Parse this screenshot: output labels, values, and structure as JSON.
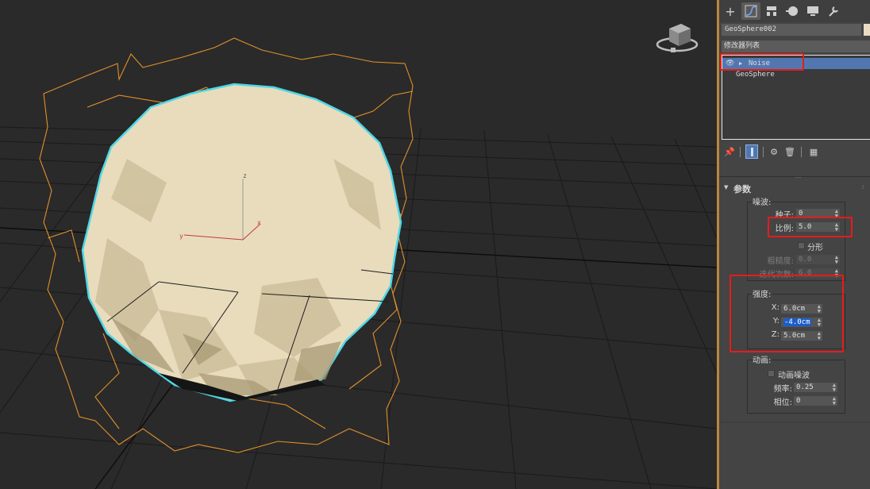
{
  "panel": {
    "tabs": [
      {
        "name": "create-tab",
        "icon": "plus-icon",
        "glyph": "+"
      },
      {
        "name": "modify-tab",
        "icon": "modify-curve-icon",
        "glyph": "⌐"
      },
      {
        "name": "hierarchy-tab",
        "icon": "hierarchy-icon",
        "glyph": "▤"
      },
      {
        "name": "motion-tab",
        "icon": "motion-icon",
        "glyph": "◐"
      },
      {
        "name": "display-tab",
        "icon": "monitor-icon",
        "glyph": "▀"
      },
      {
        "name": "utilities-tab",
        "icon": "wrench-icon",
        "glyph": "✎"
      }
    ],
    "object_name": "GeoSphere002",
    "object_color": "#e9dcc2",
    "modifier_list_label": "修改器列表",
    "stack": [
      {
        "label": "Noise",
        "selected": true
      },
      {
        "label": "GeoSphere",
        "selected": false
      }
    ],
    "rollout_title": "参数",
    "noise_group_label": "噪波:",
    "seed_label": "种子:",
    "seed_value": "0",
    "scale_label": "比例:",
    "scale_value": "5.0",
    "fractal_label": "分形",
    "roughness_label": "粗糙度:",
    "roughness_value": "0.0",
    "iterations_label": "迭代次数:",
    "iterations_value": "6.0",
    "strength_group_label": "强度:",
    "x_label": "X:",
    "x_value": "6.0cm",
    "y_label": "Y:",
    "y_value": "-4.0cm",
    "z_label": "Z:",
    "z_value": "5.0cm",
    "animation_group_label": "动画:",
    "animate_noise_label": "动画噪波",
    "frequency_label": "频率:",
    "frequency_value": "0.25",
    "phase_label": "相位:",
    "phase_value": "0"
  },
  "viewport": {
    "gizmo_axes": {
      "x": "x",
      "y": "y",
      "z": "z"
    },
    "sphere_color": "#e8dcbd",
    "selection_color": "#4fd7e6",
    "lattice_color": "#e0902b"
  },
  "accent": {
    "highlight": "#e81b1b",
    "selection": "#5277b0"
  }
}
